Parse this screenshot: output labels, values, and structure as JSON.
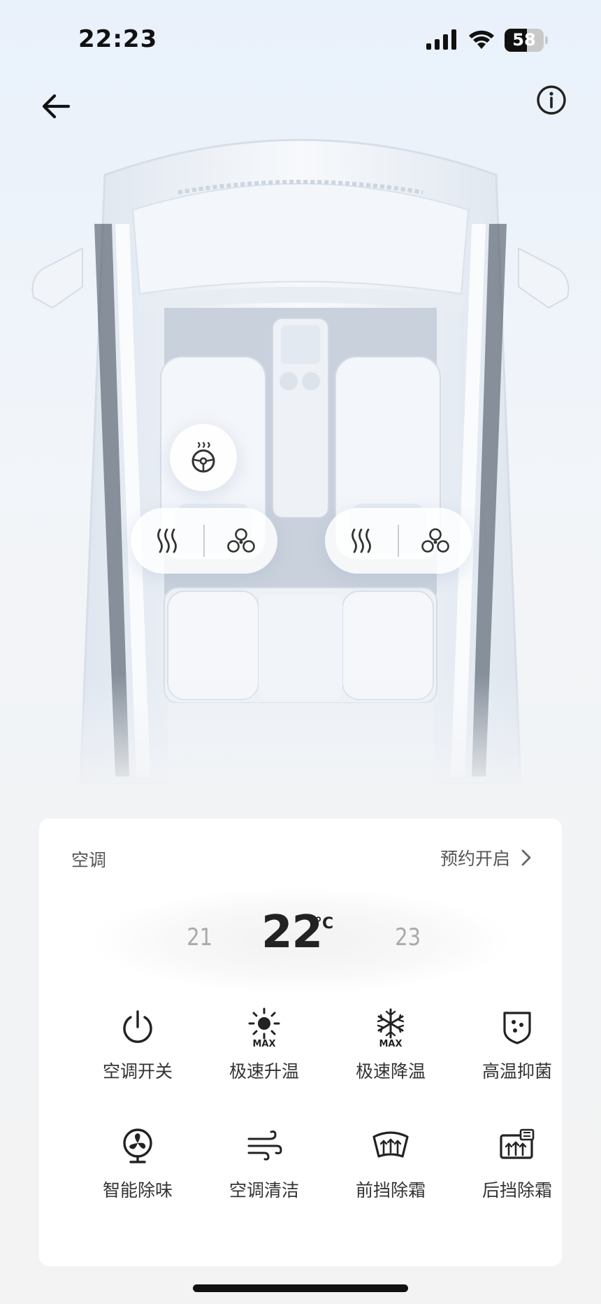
{
  "status_bar": {
    "time": "22:23",
    "battery_level": "58",
    "battery_percent": 58
  },
  "header": {
    "back_icon": "arrow-left-icon",
    "info_icon": "info-icon"
  },
  "car": {
    "steering_wheel_heat_icon": "steering-wheel-heat-icon",
    "seats": [
      {
        "heat_icon": "seat-heat-icon",
        "vent_icon": "seat-ventilation-fan-icon"
      },
      {
        "heat_icon": "seat-heat-icon",
        "vent_icon": "seat-ventilation-fan-icon"
      }
    ]
  },
  "ac_panel": {
    "title": "空调",
    "schedule_label": "预约开启",
    "temperature": {
      "lower": "21",
      "current": "22",
      "unit": "°C",
      "higher": "23"
    },
    "functions": [
      {
        "label": "空调开关",
        "icon": "power-icon"
      },
      {
        "label": "极速升温",
        "icon": "sun-max-icon"
      },
      {
        "label": "极速降温",
        "icon": "snowflake-max-icon"
      },
      {
        "label": "高温抑菌",
        "icon": "shield-sterilize-icon"
      },
      {
        "label": "智能除味",
        "icon": "fan-deodorize-icon"
      },
      {
        "label": "空调清洁",
        "icon": "wind-clean-icon"
      },
      {
        "label": "前挡除霜",
        "icon": "front-defrost-icon"
      },
      {
        "label": "后挡除霜",
        "icon": "rear-defrost-icon"
      }
    ]
  }
}
